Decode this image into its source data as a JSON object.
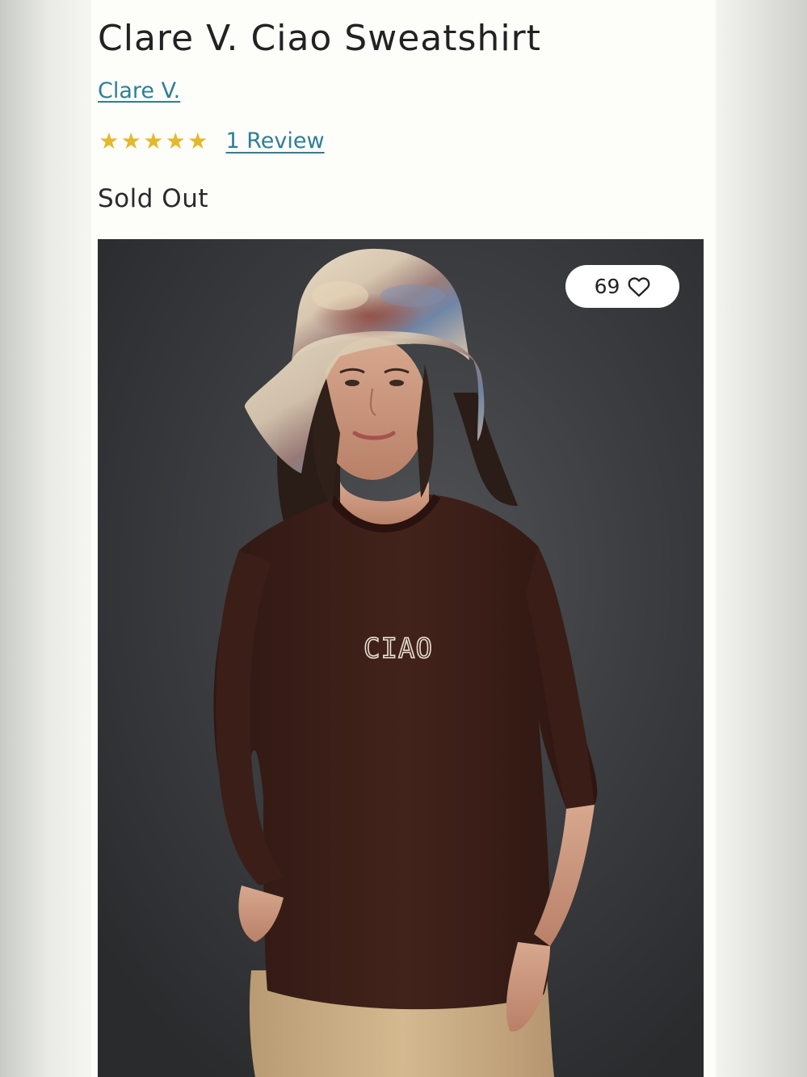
{
  "product": {
    "title": "Clare V. Ciao Sweatshirt",
    "brand": "Clare V.",
    "rating": 5,
    "rating_max": 5,
    "review_label": "1 Review",
    "stock_status": "Sold Out"
  },
  "image": {
    "favorite_count": "69",
    "favorite_icon": "heart-outline-icon",
    "shirt_print": "CIAO"
  },
  "colors": {
    "link": "#2e7f96",
    "star": "#e5b82c",
    "background": "#fdfdfa",
    "photo_bg": "#3a3c3e",
    "sweatshirt": "#3d2019",
    "pants": "#c9ae86"
  }
}
